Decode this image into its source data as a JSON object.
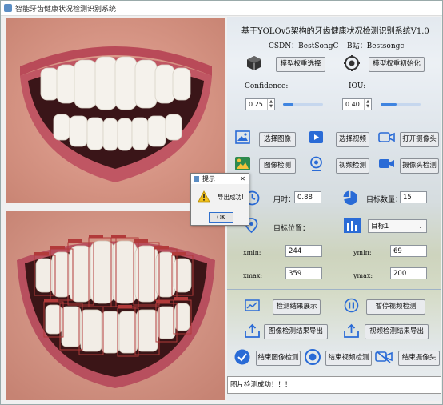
{
  "window": {
    "title": "智能牙齿健康状况检测识别系统"
  },
  "panel": {
    "title": "基于YOLOv5架构的牙齿健康状况检测识别系统V1.0",
    "csdn": "CSDN：BestSongC",
    "bilibili": "B站：Bestsongc",
    "model_select": "模型权重选择",
    "model_init": "模型权重初始化",
    "confidence_label": "Confidence:",
    "iou_label": "IOU:",
    "confidence_value": "0.25",
    "iou_value": "0.40",
    "confidence_level": 0.25,
    "iou_level": 0.4,
    "select_image": "选择图像",
    "select_video": "选择视频",
    "open_camera": "打开摄像头",
    "image_detect": "图像检测",
    "video_detect": "视频检测",
    "camera_detect": "摄像头检测",
    "time_label": "用时：",
    "time_value": "0.88",
    "count_label": "目标数量：",
    "count_value": "15",
    "position_label": "目标位置：",
    "target_select": "目标1",
    "xmin_label": "xmin:",
    "xmin_value": "244",
    "ymin_label": "ymin:",
    "ymin_value": "69",
    "xmax_label": "xmax:",
    "xmax_value": "359",
    "ymax_label": "ymax:",
    "ymax_value": "200",
    "show_results": "检测结果展示",
    "pause_video": "暂停视频检测",
    "export_image": "图像检测结果导出",
    "export_video": "视频检测结果导出",
    "end_image": "结束图像检测",
    "end_video": "结束视频检测",
    "end_camera": "结束摄像头",
    "status_text": "图片检测成功！！！"
  },
  "dialog": {
    "title": "提示",
    "message": "导出成功!",
    "ok": "OK",
    "close": "✕"
  },
  "colors": {
    "accent": "#2a6bd6",
    "box": "#b23a3a"
  }
}
